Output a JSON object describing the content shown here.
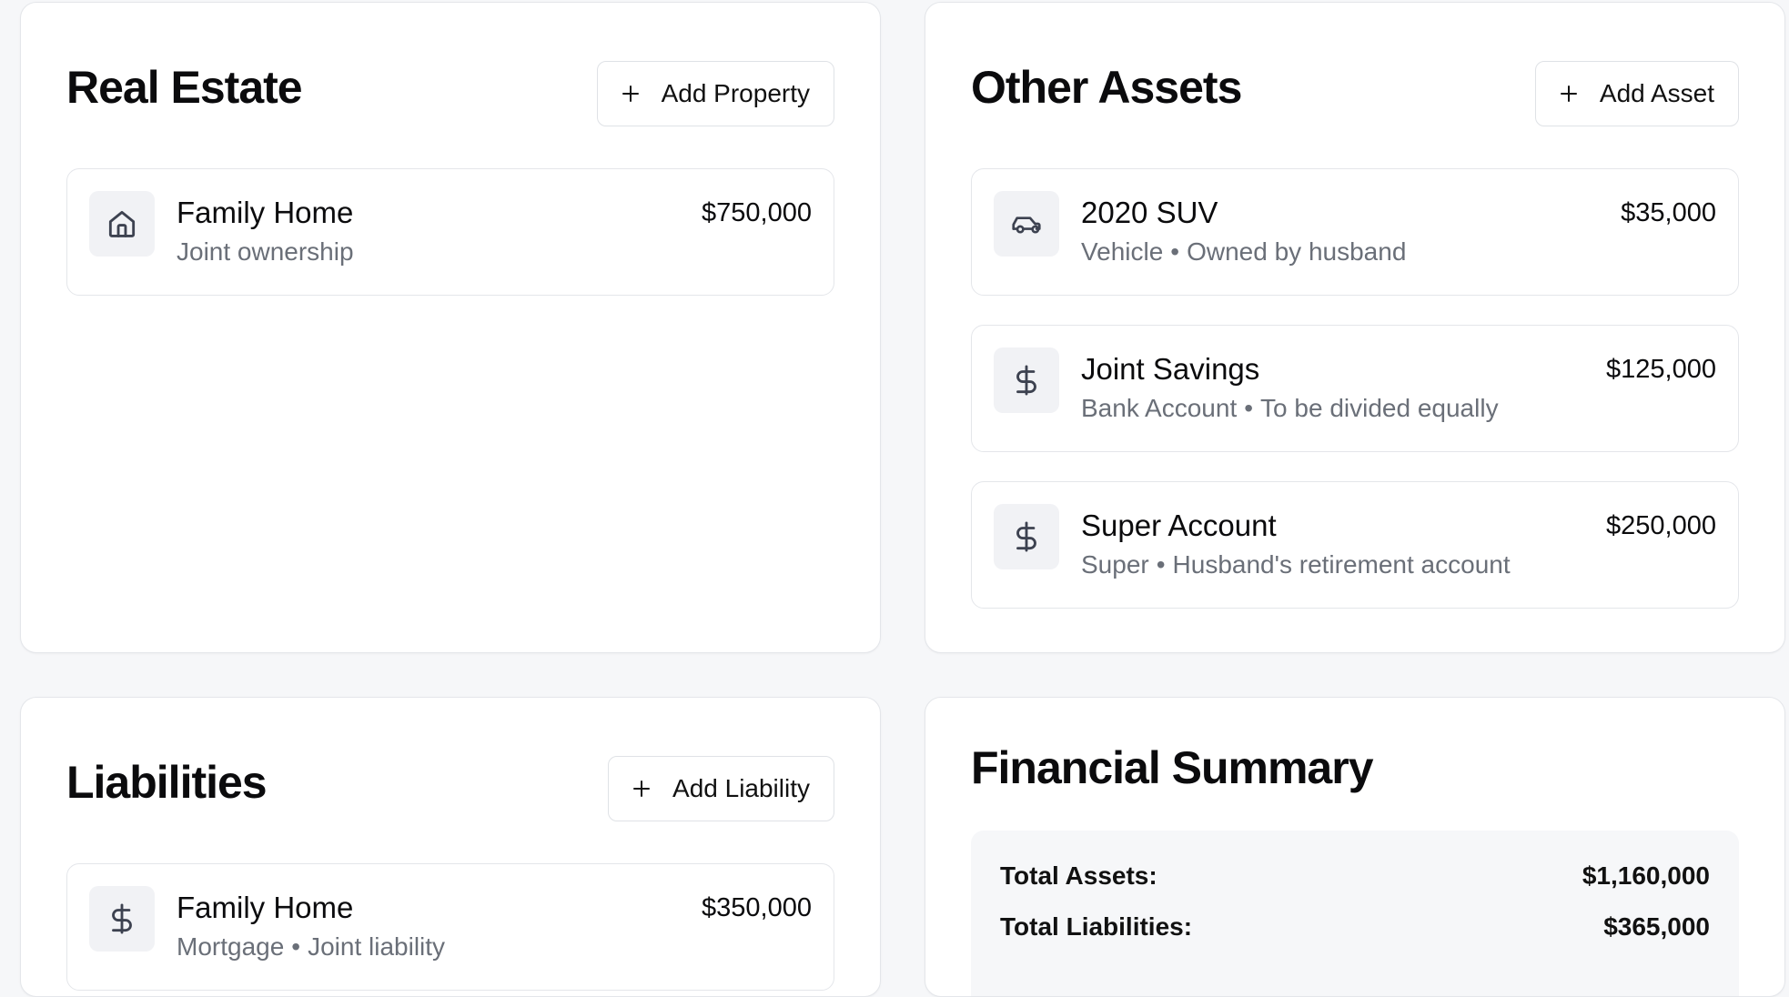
{
  "real_estate": {
    "title": "Real Estate",
    "add_label": "Add Property",
    "items": [
      {
        "title": "Family Home",
        "subtitle": [
          "Joint ownership"
        ],
        "value": "$750,000",
        "icon": "home-icon"
      }
    ]
  },
  "other_assets": {
    "title": "Other Assets",
    "add_label": "Add Asset",
    "items": [
      {
        "title": "2020 SUV",
        "subtitle": [
          "Vehicle",
          "Owned by husband"
        ],
        "value": "$35,000",
        "icon": "car-icon"
      },
      {
        "title": "Joint Savings",
        "subtitle": [
          "Bank Account",
          "To be divided equally"
        ],
        "value": "$125,000",
        "icon": "dollar-icon"
      },
      {
        "title": "Super Account",
        "subtitle": [
          "Super",
          "Husband's retirement account"
        ],
        "value": "$250,000",
        "icon": "dollar-icon"
      }
    ]
  },
  "liabilities": {
    "title": "Liabilities",
    "add_label": "Add Liability",
    "items": [
      {
        "title": "Family Home",
        "subtitle": [
          "Mortgage",
          "Joint liability"
        ],
        "value": "$350,000",
        "icon": "dollar-icon"
      }
    ]
  },
  "summary": {
    "title": "Financial Summary",
    "rows": [
      {
        "label": "Total Assets:",
        "value": "$1,160,000"
      },
      {
        "label": "Total Liabilities:",
        "value": "$365,000"
      }
    ]
  },
  "separator": "•",
  "colors": {
    "background": "#f6f7f9",
    "card": "#ffffff",
    "border": "#e4e6ea",
    "icon_bg": "#f1f2f5",
    "muted_text": "#6a6f78"
  }
}
